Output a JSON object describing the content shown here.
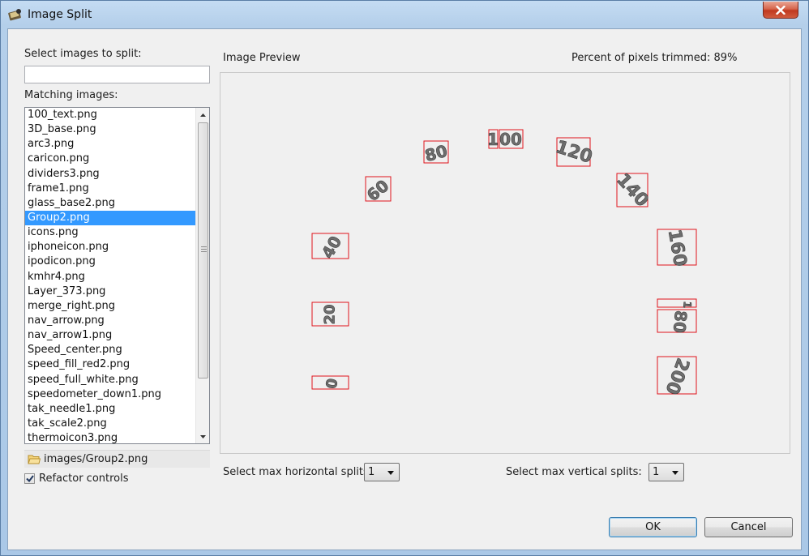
{
  "window": {
    "title": "Image Split",
    "close_label": "✕"
  },
  "left": {
    "select_label": "Select images to split:",
    "search_value": "",
    "matching_label": "Matching images:",
    "files": [
      "100_text.png",
      "3D_base.png",
      "arc3.png",
      "caricon.png",
      "dividers3.png",
      "frame1.png",
      "glass_base2.png",
      "Group2.png",
      "icons.png",
      "iphoneicon.png",
      "ipodicon.png",
      "kmhr4.png",
      "Layer_373.png",
      "merge_right.png",
      "nav_arrow.png",
      "nav_arrow1.png",
      "Speed_center.png",
      "speed_fill_red2.png",
      "speed_full_white.png",
      "speedometer_down1.png",
      "tak_needle1.png",
      "tak_scale2.png",
      "thermoicon3.png"
    ],
    "selected_index": 7,
    "path": "images/Group2.png",
    "refactor_label": "Refactor controls",
    "refactor_checked": true
  },
  "preview": {
    "label": "Image Preview",
    "trimmed_text": "Percent of pixels trimmed: 89%",
    "numbers": [
      "0",
      "20",
      "40",
      "60",
      "80",
      "1",
      "00",
      "120",
      "140",
      "160",
      "1",
      "80",
      "200"
    ]
  },
  "splits": {
    "horizontal_label": "Select max horizontal splits:",
    "horizontal_value": "1",
    "vertical_label": "Select max vertical splits:",
    "vertical_value": "1"
  },
  "buttons": {
    "ok": "OK",
    "cancel": "Cancel"
  },
  "colors": {
    "selection": "#3399ff",
    "trim_box": "#e0141c",
    "ok_border": "#3c7fb1"
  }
}
